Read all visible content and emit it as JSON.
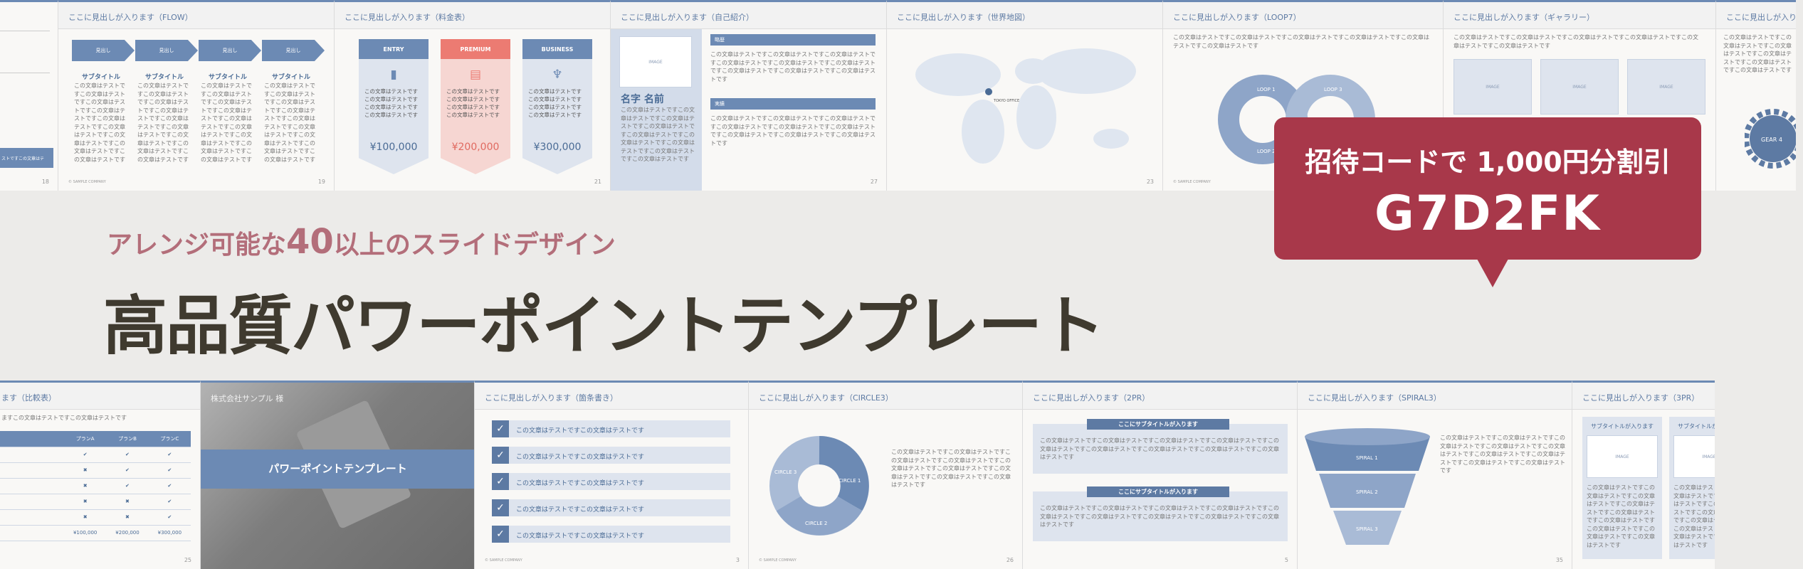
{
  "top_slides": {
    "s1": {
      "text": "ストですこの文章はテ",
      "page": "18"
    },
    "flow": {
      "heading": "ここに見出しが入ります（FLOW）",
      "steps": [
        "見出し",
        "見出し",
        "見出し",
        "見出し"
      ],
      "sub": "サブタイトル",
      "body": "この文章はテストですこの文章はテストですこの文章はテストですこの文章はテストですこの文章はテストですこの文章はテストですこの文章はテストですこの文章はテストですこの文章はテストです",
      "page": "19",
      "company": "© SAMPLE COMPANY"
    },
    "pricing": {
      "heading": "ここに見出しが入ります（料金表）",
      "plans": [
        {
          "name": "ENTRY",
          "price": "¥100,000"
        },
        {
          "name": "PREMIUM",
          "price": "¥200,000"
        },
        {
          "name": "BUSINESS",
          "price": "¥300,000"
        }
      ],
      "body": "この文章はテストですこの文章はテストですこの文章はテストですこの文章はテストです",
      "page": "21"
    },
    "profile": {
      "heading": "ここに見出しが入ります（自己紹介）",
      "image": "IMAGE",
      "name": "名字 名前",
      "bar1": "略歴",
      "bar2": "実績",
      "body": "この文章はテストですこの文章はテストですこの文章はテストですこの文章はテストですこの文章はテストですこの文章はテストですこの文章はテストですこの文章はテストですこの文章はテストです",
      "page": "27"
    },
    "map": {
      "heading": "ここに見出しが入ります（世界地図）",
      "pin": "TOKYO OFFICE",
      "page": "23"
    },
    "loop": {
      "heading": "ここに見出しが入ります（LOOP7）",
      "labels": [
        "LOOP 1",
        "LOOP 2",
        "LOOP 3",
        "LOOP 4"
      ],
      "body": "この文章はテストですこの文章はテストですこの文章はテストですこの文章はテストですこの文章はテストですこの文章はテストです"
    },
    "gallery": {
      "heading": "ここに見出しが入ります（ギャラリー）",
      "image": "IMAGE"
    },
    "gear": {
      "heading": "ここに見出しが入ります",
      "label": "GEAR 4"
    }
  },
  "banner": {
    "line1": "招待コードで 1,000円分割引",
    "line2": "G7D2FK"
  },
  "subtitle": {
    "pre": "アレンジ可能な",
    "big": "40",
    "post": "以上のスライドデザイン"
  },
  "title": "高品質パワーポイントテンプレート",
  "bottom_slides": {
    "compare": {
      "heading": "ます（比較表）",
      "note": "ますこの文章はテストですこの文章はテストです",
      "cols": [
        "プランA",
        "プランB",
        "プランC"
      ],
      "prices": [
        "¥100,000",
        "¥200,000",
        "¥300,000"
      ],
      "page": "25"
    },
    "cover": {
      "company": "株式会社サンプル 様",
      "title": "パワーポイントテンプレート"
    },
    "bullets": {
      "heading": "ここに見出しが入ります（箇条書き）",
      "items": [
        "この文章はテストですこの文章はテストです",
        "この文章はテストですこの文章はテストです",
        "この文章はテストですこの文章はテストです",
        "この文章はテストですこの文章はテストです",
        "この文章はテストですこの文章はテストです"
      ],
      "page": "3"
    },
    "circle": {
      "heading": "ここに見出しが入ります（CIRCLE3）",
      "labels": [
        "CIRCLE 1",
        "CIRCLE 2",
        "CIRCLE 3"
      ],
      "page": "26"
    },
    "pr2": {
      "heading": "ここに見出しが入ります（2PR）",
      "sub": "ここにサブタイトルが入ります",
      "page": "5"
    },
    "spiral": {
      "heading": "ここに見出しが入ります（SPIRAL3）",
      "labels": [
        "SPIRAL 1",
        "SPIRAL 2",
        "SPIRAL 3"
      ],
      "page": "35"
    },
    "pr3": {
      "heading": "ここに見出しが入ります（3PR）",
      "sub": "サブタイトルが入ります",
      "image": "IMAGE"
    }
  }
}
